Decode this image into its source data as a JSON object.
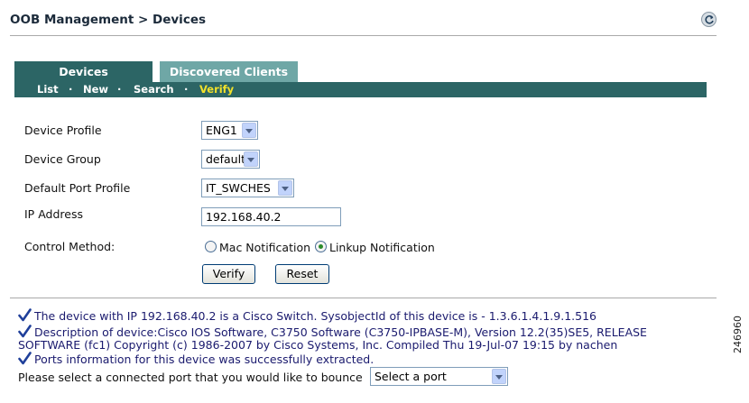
{
  "header": {
    "breadcrumb": "OOB Management > Devices"
  },
  "tabs": [
    {
      "label": "Devices",
      "active": true
    },
    {
      "label": "Discovered Clients",
      "active": false
    }
  ],
  "subnav": {
    "items": [
      "List",
      "New",
      "Search",
      "Verify"
    ],
    "active": "Verify",
    "separator": "·"
  },
  "form": {
    "device_profile_label": "Device Profile",
    "device_profile_value": "ENG1",
    "device_group_label": "Device Group",
    "device_group_value": "default",
    "port_profile_label": "Default Port Profile",
    "port_profile_value": "IT_SWCHES",
    "ip_label": "IP Address",
    "ip_value": "192.168.40.2",
    "control_label": "Control Method:",
    "control_options": [
      "Mac Notification",
      "Linkup Notification"
    ],
    "control_selected": "Linkup Notification",
    "verify_label": "Verify",
    "reset_label": "Reset"
  },
  "messages": {
    "m1": "The device with IP 192.168.40.2 is a Cisco Switch. SysobjectId of this device is - 1.3.6.1.4.1.9.1.516",
    "m2a": "Description of device:Cisco IOS Software, C3750 Software (C3750-IPBASE-M), Version 12.2(35)SE5, RELEASE",
    "m2b": "SOFTWARE (fc1) Copyright (c) 1986-2007 by Cisco Systems, Inc. Compiled Thu 19-Jul-07 19:15 by nachen",
    "m3": "Ports information for this device was successfully extracted."
  },
  "bounce": {
    "label": "Please select a connected port that you would like to bounce",
    "select_value": "Select a port"
  },
  "figure_id": "246960",
  "colors": {
    "tab_active": "#2c6565",
    "tab_inactive": "#6fa7a6",
    "subnav_active_text": "#f2e12a",
    "message_text": "#1a1a6e",
    "check_icon": "#1f3f9a"
  }
}
